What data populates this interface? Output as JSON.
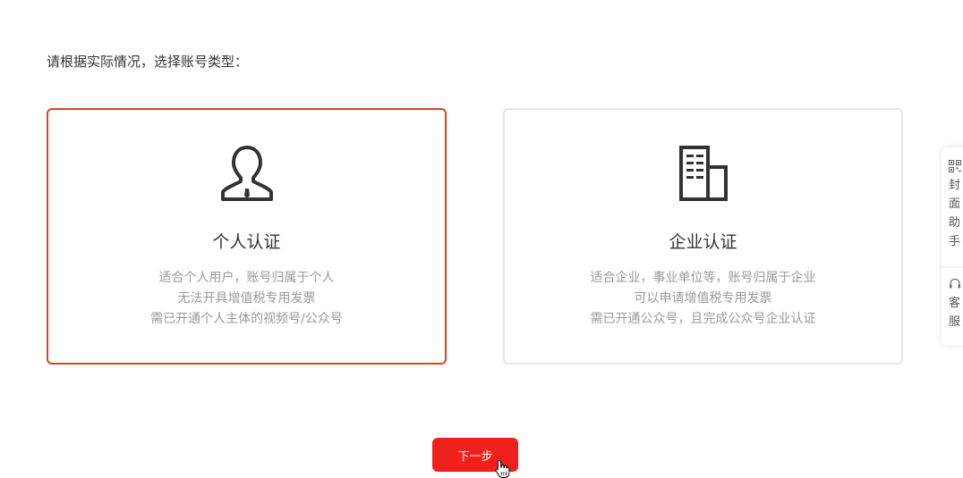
{
  "prompt": "请根据实际情况，选择账号类型：",
  "cards": {
    "personal": {
      "title": "个人认证",
      "lines": [
        "适合个人用户，账号归属于个人",
        "无法开具增值税专用发票",
        "需已开通个人主体的视频号/公众号"
      ],
      "icon": "person-icon",
      "selected": true
    },
    "enterprise": {
      "title": "企业认证",
      "lines": [
        "适合企业，事业单位等，账号归属于企业",
        "可以申请增值税专用发票",
        "需已开通公众号，且完成公众号企业认证"
      ],
      "icon": "building-icon",
      "selected": false
    }
  },
  "next_button": "下一步",
  "side_panel": {
    "cover_helper": "封面助手",
    "customer_service": "客服"
  },
  "colors": {
    "accent": "#e0431f",
    "button": "#f0211c",
    "text": "#333333",
    "muted": "#9a9a9a",
    "border": "#e6e6e6"
  }
}
